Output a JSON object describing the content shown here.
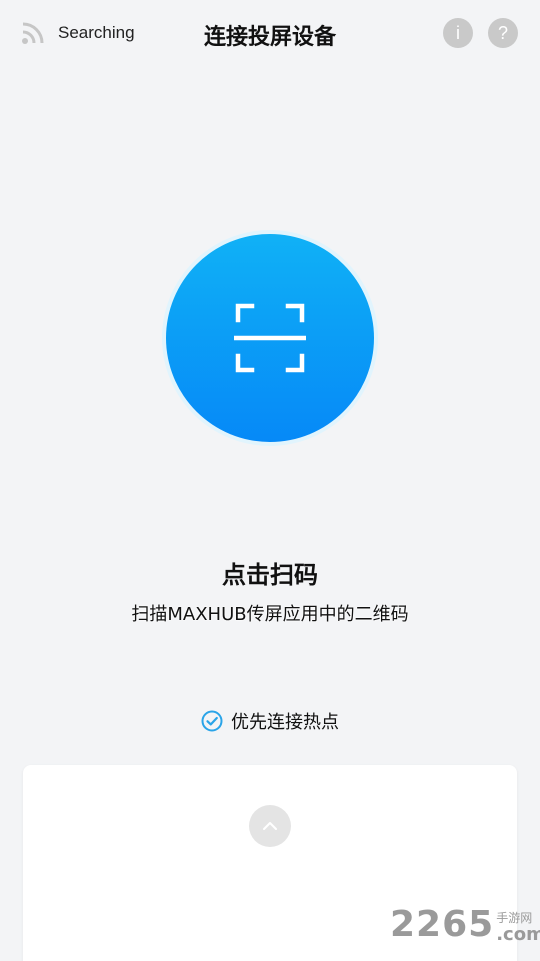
{
  "header": {
    "status_icon": "signal-searching-icon",
    "status_text": "Searching",
    "title": "连接投屏设备",
    "info_label": "i",
    "help_label": "?"
  },
  "scan": {
    "icon": "scan-qr-icon",
    "title": "点击扫码",
    "subtitle": "扫描MAXHUB传屏应用中的二维码"
  },
  "preference": {
    "checked": true,
    "label": "优先连接热点"
  },
  "panel": {
    "toggle_icon": "chevron-up-icon"
  },
  "watermark": {
    "number": "2265",
    "site_cn": "手游网",
    "site_com": ".com"
  },
  "colors": {
    "background": "#f3f4f6",
    "accent_blue": "#0a9cf7",
    "check_blue": "#2aa4e8"
  }
}
